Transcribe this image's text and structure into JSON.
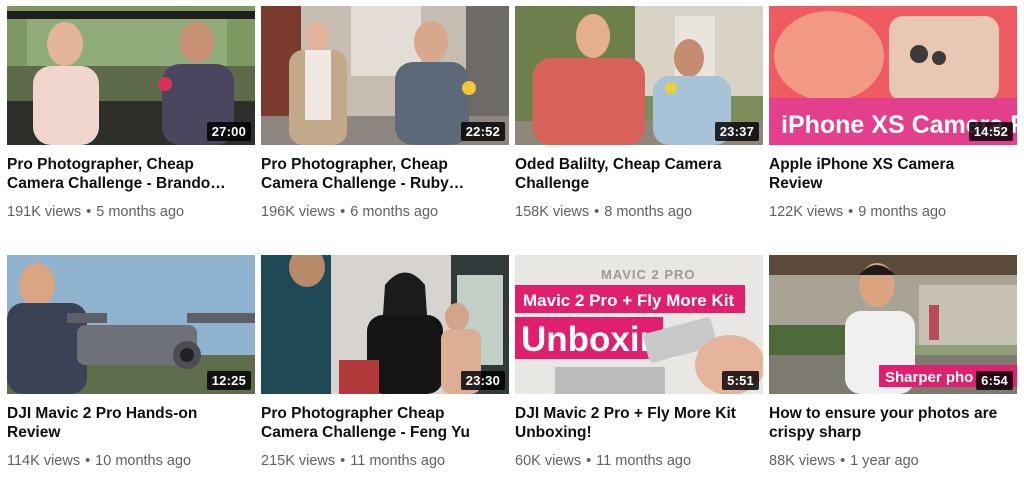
{
  "videos": [
    {
      "title": "Pro Photographer, Cheap Camera Challenge - Brando…",
      "duration": "27:00",
      "views": "191K views",
      "age": "5 months ago",
      "thumb_text": ""
    },
    {
      "title": "Pro Photographer, Cheap Camera Challenge - Ruby…",
      "duration": "22:52",
      "views": "196K views",
      "age": "6 months ago",
      "thumb_text": ""
    },
    {
      "title": "Oded Balilty, Cheap Camera Challenge",
      "duration": "23:37",
      "views": "158K views",
      "age": "8 months ago",
      "thumb_text": ""
    },
    {
      "title": "Apple iPhone XS Camera Review",
      "duration": "14:52",
      "views": "122K views",
      "age": "9 months ago",
      "thumb_text": "iPhone XS Camera Re"
    },
    {
      "title": "DJI Mavic 2 Pro Hands-on Review",
      "duration": "12:25",
      "views": "114K views",
      "age": "10 months ago",
      "thumb_text": ""
    },
    {
      "title": "Pro Photographer Cheap Camera Challenge - Feng Yu",
      "duration": "23:30",
      "views": "215K views",
      "age": "11 months ago",
      "thumb_text": ""
    },
    {
      "title": "DJI Mavic 2 Pro + Fly More Kit Unboxing!",
      "duration": "5:51",
      "views": "60K views",
      "age": "11 months ago",
      "thumb_text": "Mavic 2 Pro + Fly More Kit",
      "thumb_text_2": "Unboxing",
      "thumb_text_3": "MAVIC 2 PRO"
    },
    {
      "title": "How to ensure your photos are crispy sharp",
      "duration": "6:54",
      "views": "88K views",
      "age": "1 year ago",
      "thumb_text": "Sharper pho"
    }
  ],
  "separator": "•",
  "colors": {
    "title": "#0f0f0f",
    "meta": "#606060",
    "accent_pink": "#e01f6e"
  }
}
